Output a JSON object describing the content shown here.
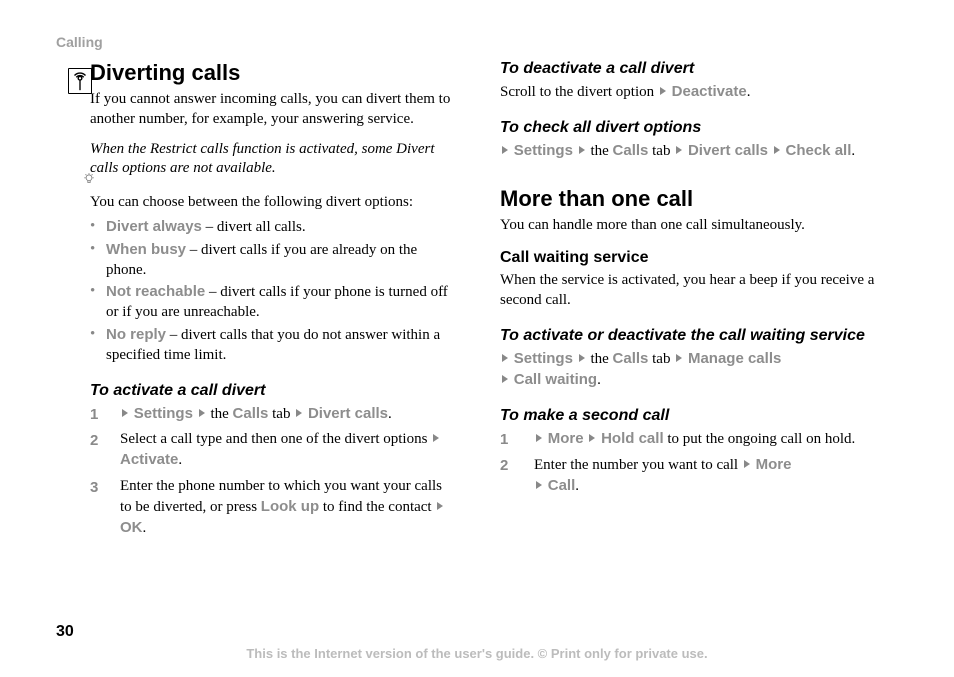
{
  "header": "Calling",
  "page_number": "30",
  "footer": "This is the Internet version of the user's guide. © Print only for private use.",
  "left": {
    "h1": "Diverting calls",
    "intro": "If you cannot answer incoming calls, you can divert them to another number, for example, your answering service.",
    "note": "When the Restrict calls function is activated, some Divert calls options are not available.",
    "options_intro": "You can choose between the following divert options:",
    "bullets": [
      {
        "label": "Divert always",
        "rest": " – divert all calls."
      },
      {
        "label": "When busy",
        "rest": " – divert calls if you are already on the phone."
      },
      {
        "label": "Not reachable",
        "rest": " – divert calls if your phone is turned off or if you are unreachable."
      },
      {
        "label": "No reply",
        "rest": " – divert calls that you do not answer within a specified time limit."
      }
    ],
    "activate_h": "To activate a call divert",
    "step1": {
      "settings": "Settings",
      "the": " the ",
      "calls": "Calls",
      "tab": " tab ",
      "divert": "Divert calls",
      "end": "."
    },
    "step2": {
      "pre": "Select a call type and then one of the divert options ",
      "activate": "Activate",
      "end": "."
    },
    "step3": {
      "pre": "Enter the phone number to which you want your calls to be diverted, or press ",
      "lookup": "Look up",
      "mid": " to find the contact ",
      "ok": "OK",
      "end": "."
    }
  },
  "right": {
    "deact_h": "To deactivate a call divert",
    "deact": {
      "pre": "Scroll to the divert option ",
      "label": "Deactivate",
      "end": "."
    },
    "check_h": "To check all divert options",
    "check": {
      "settings": "Settings",
      "the": " the ",
      "calls": "Calls",
      "tab": " tab ",
      "divert": "Divert calls",
      "checkall": "Check all",
      "end": "."
    },
    "h2": "More than one call",
    "more_intro": "You can handle more than one call simultaneously.",
    "waiting_h": "Call waiting service",
    "waiting_p": "When the service is activated, you hear a beep if you receive a second call.",
    "actwait_h": "To activate or deactivate the call waiting service",
    "actwait": {
      "settings": "Settings",
      "the": " the ",
      "calls": "Calls",
      "tab": " tab ",
      "manage": "Manage calls",
      "callwaiting": "Call waiting",
      "end": "."
    },
    "second_h": "To make a second call",
    "second1": {
      "more": "More",
      "hold": "Hold call",
      "rest": " to put the ongoing call on hold."
    },
    "second2": {
      "pre": "Enter the number you want to call ",
      "more": "More",
      "call": "Call",
      "end": "."
    }
  }
}
